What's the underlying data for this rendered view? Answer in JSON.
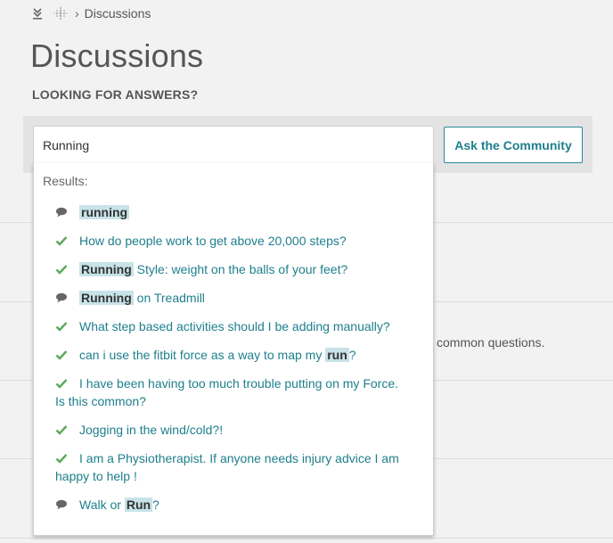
{
  "breadcrumb": {
    "current": "Discussions"
  },
  "page": {
    "title": "Discussions",
    "subtitle": "LOOKING FOR ANSWERS?"
  },
  "search": {
    "value": "Running",
    "placeholder": ""
  },
  "ask_button": {
    "label": "Ask the Community"
  },
  "background": {
    "partial_text": "common questions."
  },
  "results": {
    "label": "Results:",
    "items": [
      {
        "icon": "speech-bubble-icon",
        "before": "",
        "highlight": "running",
        "after": "",
        "line2": ""
      },
      {
        "icon": "checkmark-icon",
        "before": "How do people work to get above 20,000 steps?",
        "highlight": "",
        "after": "",
        "line2": ""
      },
      {
        "icon": "checkmark-icon",
        "before": "",
        "highlight": "Running",
        "after": " Style: weight on the balls of your feet?",
        "line2": ""
      },
      {
        "icon": "speech-bubble-icon",
        "before": "",
        "highlight": "Running",
        "after": " on Treadmill",
        "line2": ""
      },
      {
        "icon": "checkmark-icon",
        "before": "What step based activities should I be adding manually?",
        "highlight": "",
        "after": "",
        "line2": ""
      },
      {
        "icon": "checkmark-icon",
        "before": "can i use the fitbit force as a way to map my ",
        "highlight": "run",
        "after": "?",
        "line2": ""
      },
      {
        "icon": "checkmark-icon",
        "before": "I have been having too much trouble putting on my Force.",
        "highlight": "",
        "after": "",
        "line2": "Is this common?"
      },
      {
        "icon": "checkmark-icon",
        "before": "Jogging in the wind/cold?!",
        "highlight": "",
        "after": "",
        "line2": ""
      },
      {
        "icon": "checkmark-icon",
        "before": "I am a Physiotherapist. If anyone needs injury advice I am",
        "highlight": "",
        "after": "",
        "line2": "happy to help !"
      },
      {
        "icon": "speech-bubble-icon",
        "before": "Walk or ",
        "highlight": "Run",
        "after": "?",
        "line2": ""
      }
    ]
  },
  "colors": {
    "accent": "#1e7f8c",
    "check": "#5aa85a",
    "bubble": "#666666",
    "highlight_bg": "#c7e3e8"
  }
}
